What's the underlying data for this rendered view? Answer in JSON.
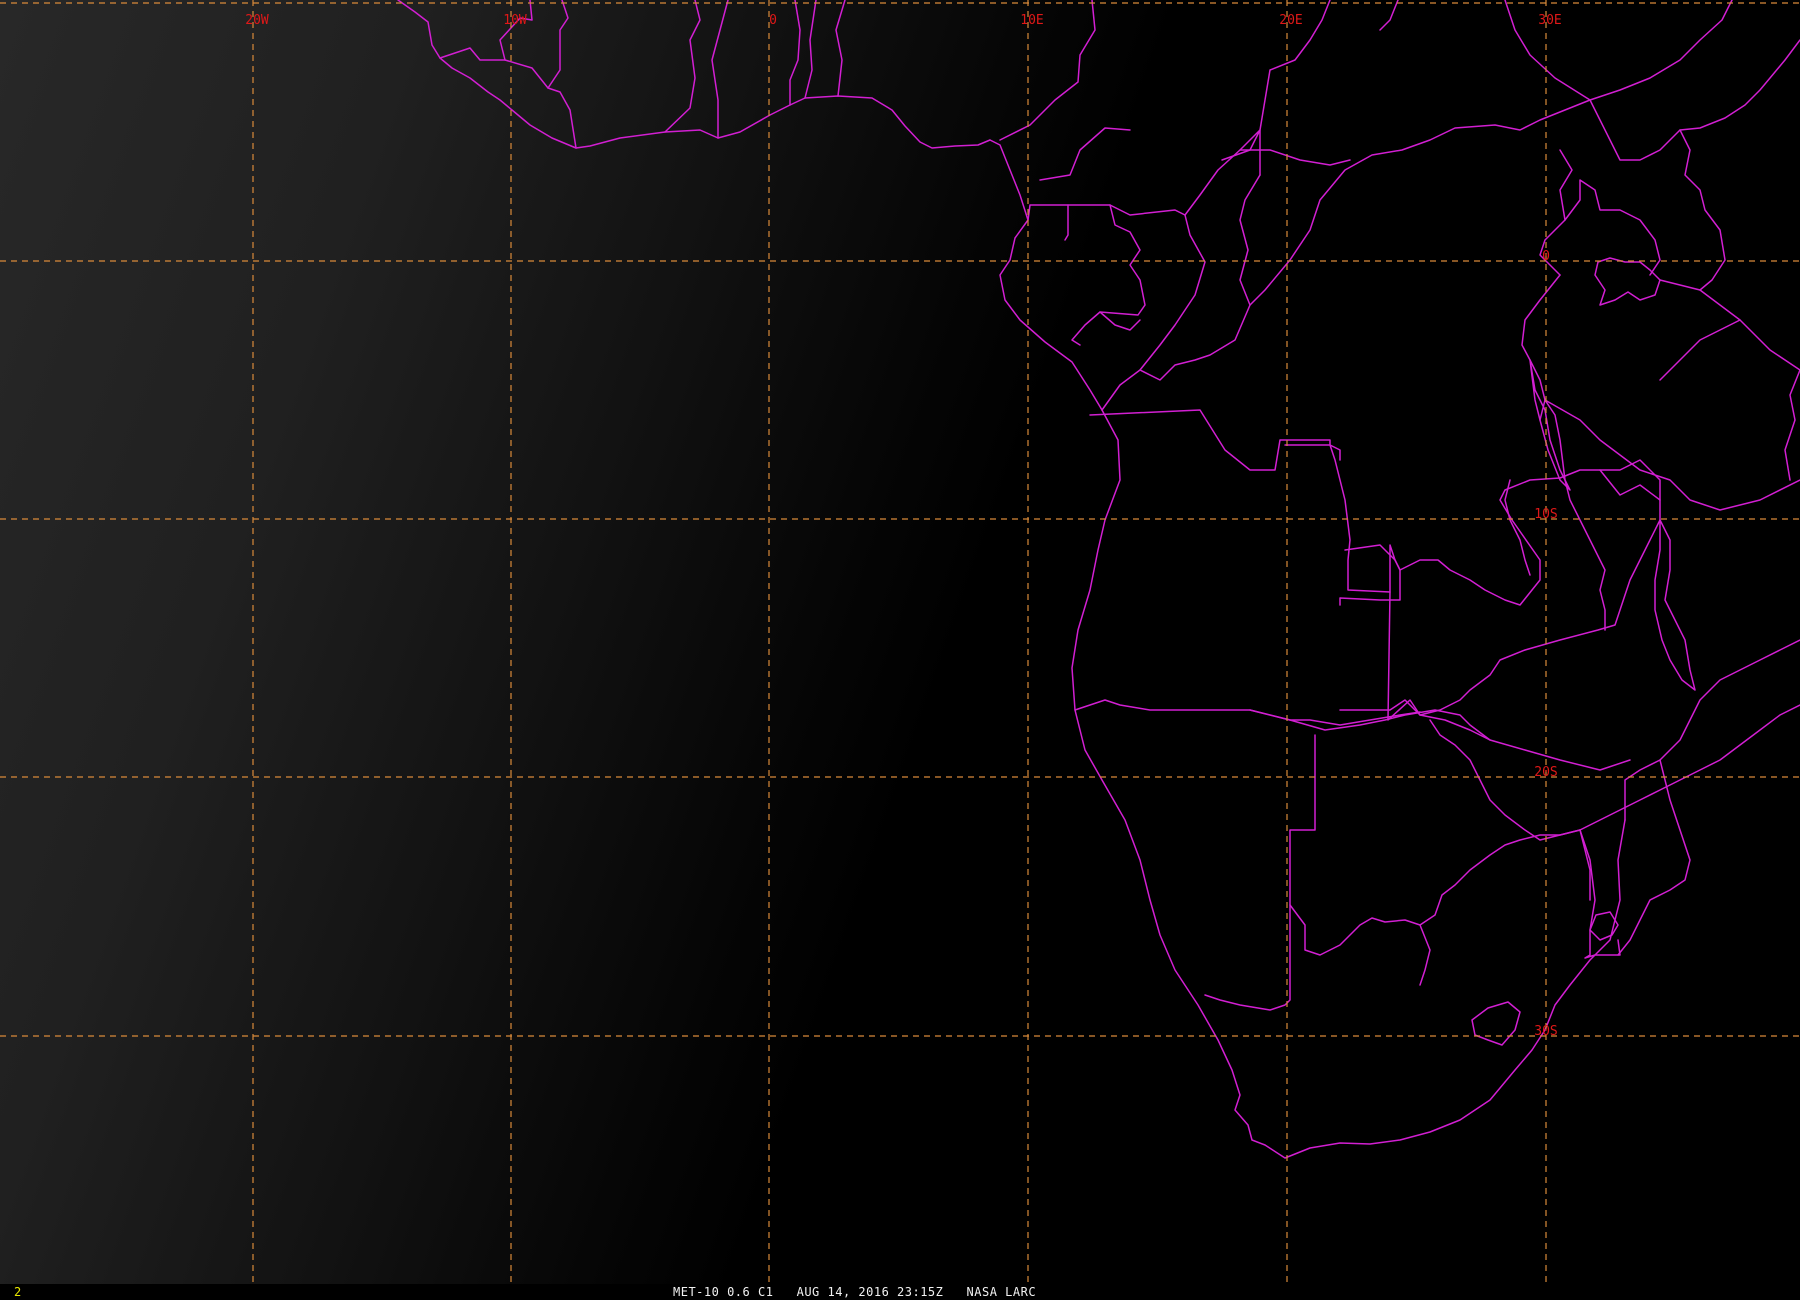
{
  "image": {
    "caption": "MET-10 0.6 C1   AUG 14, 2016 23:15Z   NASA LARC",
    "frame_number": "2",
    "colors": {
      "background": "#000000",
      "grid": "#d98a3a",
      "borders": "#d21fd2",
      "grid_labels": "#e01818",
      "frame_number": "#e8e800",
      "caption": "#f2f2f2"
    }
  },
  "grid": {
    "longitude_labels": [
      "20W",
      "10W",
      "0",
      "10E",
      "20E",
      "30E"
    ],
    "latitude_labels": [
      "0",
      "10S",
      "20S",
      "30S"
    ]
  }
}
